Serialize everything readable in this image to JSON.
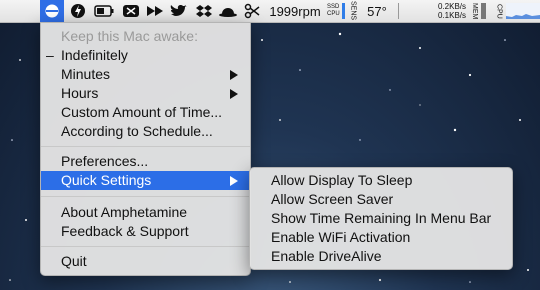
{
  "menubar": {
    "fan_speed": "1999rpm",
    "ssd_label": "SSD",
    "cpu_label": "CPU",
    "sensor_label": "SENS",
    "temperature": "57°",
    "net_up": "0.2KB/s",
    "net_down": "0.1KB/s",
    "mem_label": "MEM",
    "cpu2_label": "CPU",
    "icons": [
      "amphetamine-icon",
      "bolt-icon",
      "battery-icon",
      "scissors-toggle-icon",
      "forward-icon",
      "twitter-icon",
      "dropbox-icon",
      "bowler-hat-icon",
      "scissors-icon"
    ]
  },
  "menu": {
    "header": "Keep this Mac awake:",
    "items": [
      {
        "label": "Indefinitely",
        "mark": "–"
      },
      {
        "label": "Minutes",
        "submenu": true
      },
      {
        "label": "Hours",
        "submenu": true
      },
      {
        "label": "Custom Amount of Time..."
      },
      {
        "label": "According to Schedule..."
      },
      {
        "label": "Preferences..."
      },
      {
        "label": "Quick Settings",
        "submenu": true,
        "selected": true
      },
      {
        "label": "About Amphetamine"
      },
      {
        "label": "Feedback & Support"
      },
      {
        "label": "Quit"
      }
    ]
  },
  "submenu": {
    "items": [
      {
        "label": "Allow Display To Sleep"
      },
      {
        "label": "Allow Screen Saver"
      },
      {
        "label": "Show Time Remaining In Menu Bar"
      },
      {
        "label": "Enable WiFi Activation"
      },
      {
        "label": "Enable DriveAlive"
      }
    ]
  },
  "colors": {
    "accent": "#2c6ee7",
    "menu_bg": "#e4e4e4",
    "desktop": "#1f3452"
  }
}
